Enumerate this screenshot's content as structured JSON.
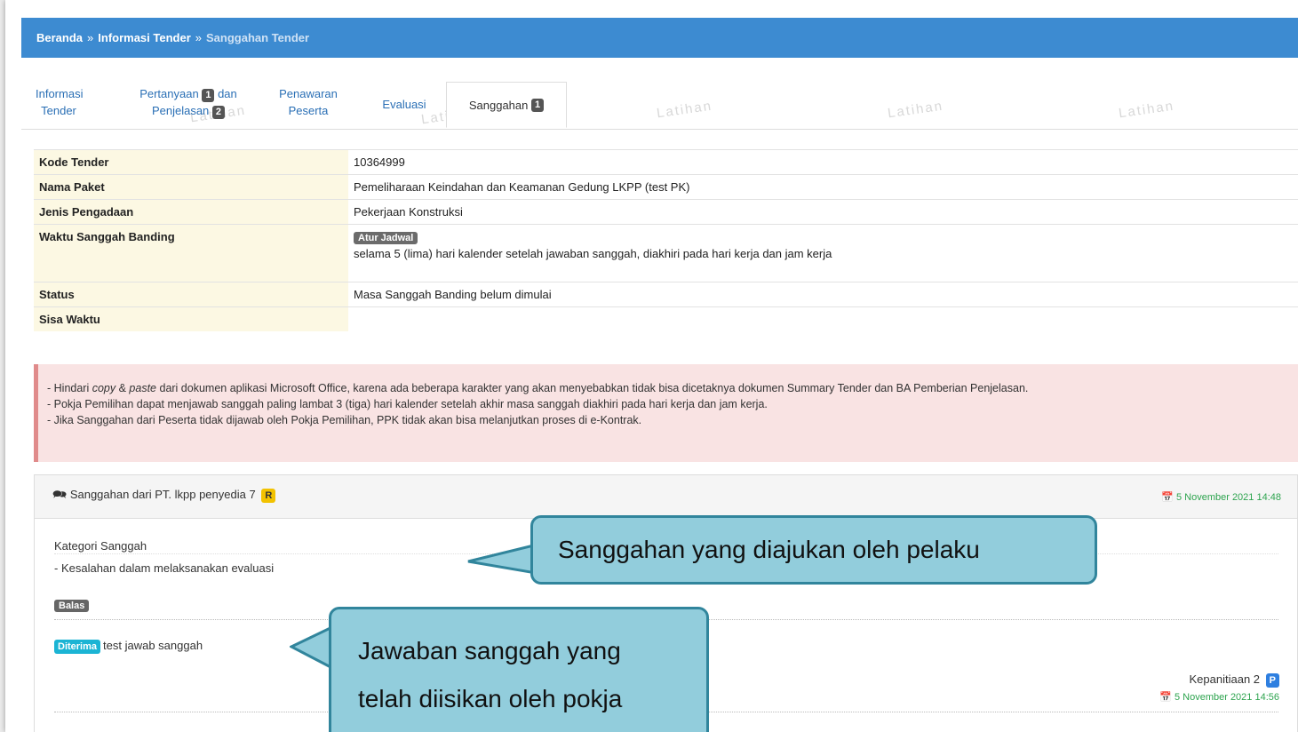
{
  "breadcrumb": {
    "home": "Beranda",
    "info": "Informasi Tender",
    "current": "Sanggahan Tender",
    "sep": "»"
  },
  "tabs": [
    {
      "l1": "Informasi",
      "l2": "Tender"
    },
    {
      "l1": "Pertanyaan",
      "b1": "1",
      "l1b": "dan",
      "l2": "Penjelasan",
      "b2": "2"
    },
    {
      "l1": "Penawaran",
      "l2": "Peserta"
    },
    {
      "l1": "Evaluasi"
    },
    {
      "l1": "Sanggahan",
      "b1": "1"
    }
  ],
  "watermark": "Latihan",
  "info": {
    "kode_label": "Kode Tender",
    "kode_value": "10364999",
    "nama_label": "Nama Paket",
    "nama_value": "Pemeliharaan Keindahan dan Keamanan Gedung LKPP (test PK)",
    "jenis_label": "Jenis Pengadaan",
    "jenis_value": "Pekerjaan Konstruksi",
    "waktu_label": "Waktu Sanggah Banding",
    "waktu_button": "Atur Jadwal",
    "waktu_value": "selama 5 (lima) hari kalender setelah jawaban sanggah, diakhiri pada hari kerja dan jam kerja",
    "status_label": "Status",
    "status_value": "Masa Sanggah Banding belum dimulai",
    "sisa_label": "Sisa Waktu",
    "sisa_value": ""
  },
  "alert": {
    "l1a": "- Hindari ",
    "l1copy": "copy",
    "l1amp": " & ",
    "l1paste": "paste",
    "l1b": " dari dokumen aplikasi Microsoft Office, karena ada beberapa karakter yang akan menyebabkan tidak bisa dicetaknya dokumen Summary Tender dan BA Pemberian Penjelasan.",
    "l2": "- Pokja Pemilihan dapat menjawab sanggah paling lambat 3 (tiga) hari kalender setelah akhir masa sanggah diakhiri pada hari kerja dan jam kerja.",
    "l3": "- Jika Sanggahan dari Peserta tidak dijawab oleh Pokja Pemilihan, PPK tidak akan bisa melanjutkan proses di e-Kontrak."
  },
  "panel": {
    "title": "Sanggahan dari PT. lkpp penyedia 7",
    "title_badge": "R",
    "date": "5 November 2021 14:48",
    "kategori_label": "Kategori Sanggah",
    "kategori_item": "-  Kesalahan dalam melaksanakan evaluasi",
    "balas": "Balas",
    "reply_badge": "Diterima",
    "reply_text": "test jawab sanggah",
    "author": "Kepanitiaan 2",
    "author_badge": "P",
    "reply_date": "5 November 2021 14:56"
  },
  "callouts": {
    "c1": "Sanggahan yang diajukan oleh pelaku",
    "c2_l1": "Jawaban sanggah yang",
    "c2_l2": "telah diisikan oleh pokja"
  },
  "colors": {
    "header": "#3d8bd1",
    "callout_fill": "#92cddc",
    "callout_border": "#31859c",
    "label_bg": "#fcf8e3",
    "alert_bg": "#f9e3e3"
  }
}
